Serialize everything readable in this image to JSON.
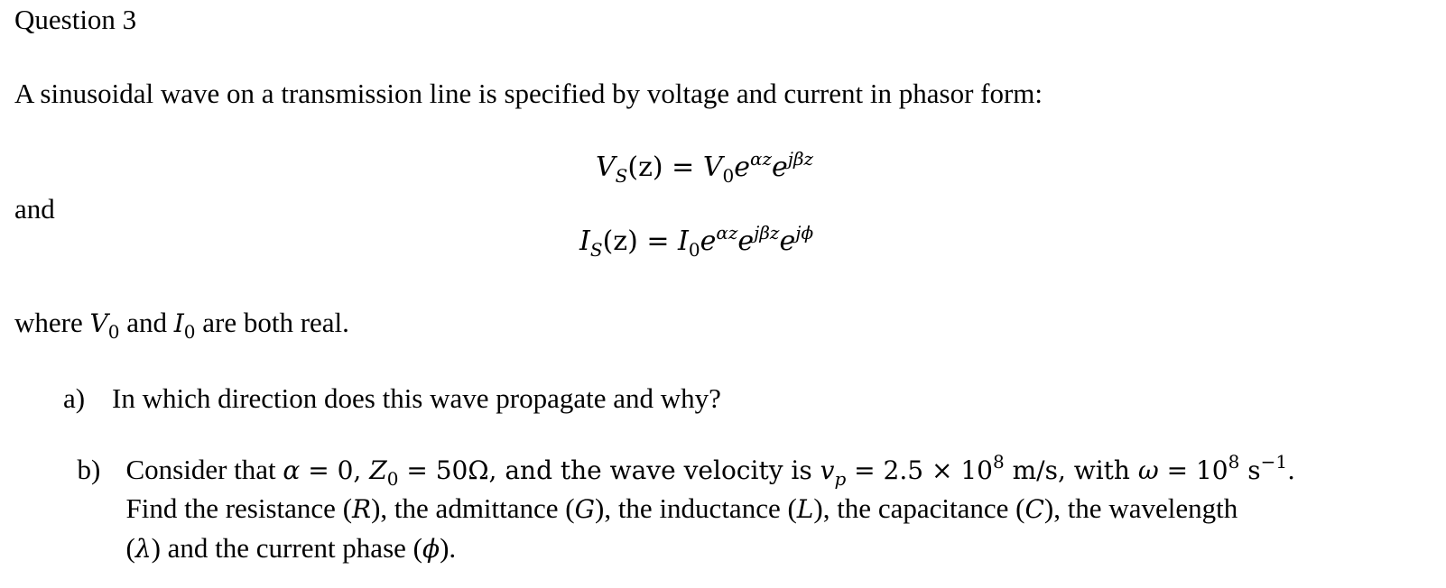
{
  "question": {
    "title": "Question 3",
    "intro": "A sinusoidal wave on a transmission line is specified by voltage and current in phasor form:",
    "and_label": "and",
    "equations": [
      {
        "lhs_var": "V",
        "lhs_sub": "S",
        "lhs_arg": "(z)",
        "eq": " = ",
        "coef": "V",
        "coef_sub": "0",
        "factors": [
          {
            "base": "e",
            "exp": "αz"
          },
          {
            "base": "e",
            "exp": "jβz"
          }
        ]
      },
      {
        "lhs_var": "I",
        "lhs_sub": "S",
        "lhs_arg": "(z)",
        "eq": " = ",
        "coef": "I",
        "coef_sub": "0",
        "factors": [
          {
            "base": "e",
            "exp": "αz"
          },
          {
            "base": "e",
            "exp": "jβz"
          },
          {
            "base": "e",
            "exp": "jϕ"
          }
        ]
      }
    ],
    "where": {
      "prefix": "where ",
      "v": "V",
      "v_sub": "0",
      "mid": " and ",
      "i": "I",
      "i_sub": "0",
      "suffix": " are both real."
    },
    "parts": {
      "a": {
        "label": "a)",
        "text": "In which direction does this wave propagate and why?"
      },
      "b": {
        "label": "b)",
        "t1": "Consider that ",
        "alpha": "α",
        "t2": " = 0, ",
        "z": "Z",
        "z_sub": "0",
        "t3": " = 50Ω, and the wave velocity is ",
        "vp": "v",
        "vp_sub": "p",
        "t4": " = 2.5 × 10",
        "exp8a": "8",
        "t5": " m/s, with ",
        "omega": "ω",
        "t6": " = 10",
        "exp8b": "8",
        "t7": " s",
        "exp_neg1": "−1",
        "t8": ".",
        "line2": {
          "a": "Find the resistance (",
          "R": "R",
          "b": "), the admittance (",
          "G": "G",
          "c": "), the inductance (",
          "L": "L",
          "d": "), the capacitance (",
          "C": "C",
          "e": "), the wavelength"
        },
        "line3": {
          "a": "(",
          "lambda": "λ",
          "b": ") and the current phase (",
          "phi": "ϕ",
          "c": ")."
        }
      }
    }
  }
}
